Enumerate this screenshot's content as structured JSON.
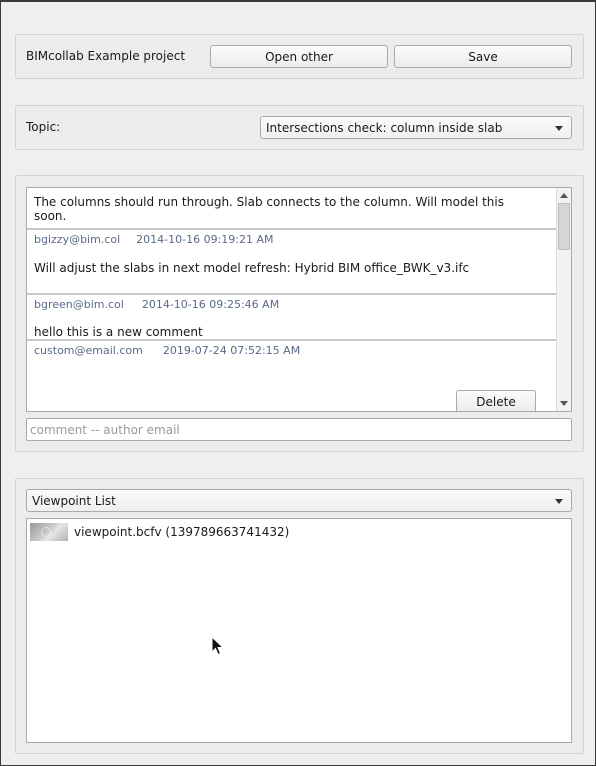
{
  "project": {
    "name": "BIMcollab Example project",
    "open_other_label": "Open other",
    "save_label": "Save"
  },
  "topic": {
    "label": "Topic:",
    "selected": "Intersections check: column inside slab"
  },
  "comments": [
    {
      "text": "The columns should run through. Slab connects to the column. Will model this soon.",
      "author": "bgizzy@bim.col",
      "date": "2014-10-16 09:19:21 AM"
    },
    {
      "text": "Will adjust the slabs in next model refresh: Hybrid BIM office_BWK_v3.ifc",
      "author": "bgreen@bim.col",
      "date": "2014-10-16 09:25:46 AM"
    },
    {
      "text": "hello this is a new comment",
      "author": "custom@email.com",
      "date": "2019-07-24 07:52:15 AM"
    }
  ],
  "delete_label": "Delete",
  "comment_input": {
    "value": "",
    "placeholder": "comment -- author email"
  },
  "viewpoints": {
    "dropdown_selected": "Viewpoint List",
    "items": [
      {
        "label": "viewpoint.bcfv (139789663741432)",
        "icon": "viewpoint-thumbnail"
      }
    ]
  },
  "colors": {
    "window_bg": "#efefef",
    "meta_text": "#5a6a8a"
  }
}
